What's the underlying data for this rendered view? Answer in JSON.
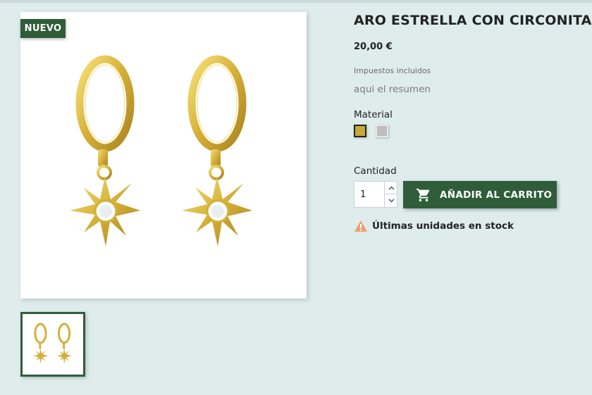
{
  "product": {
    "badge": "NUEVO",
    "title": "ARO ESTRELLA CON CIRCONITA",
    "price": "20,00 €",
    "tax_note": "Impuestos incluidos",
    "summary": "aqui el resumen",
    "material_label": "Material",
    "materials": [
      {
        "name": "gold",
        "color": "#c9a93a",
        "selected": true
      },
      {
        "name": "silver",
        "color": "#bdbdbd",
        "selected": false
      }
    ]
  },
  "purchase": {
    "quantity_label": "Cantidad",
    "quantity_value": "1",
    "add_to_cart_label": "AÑADIR AL CARRITO",
    "stock_message": "Últimas unidades en stock"
  },
  "theme": {
    "accent": "#2f5d3a",
    "background": "#deecec",
    "warning": "#f39d72",
    "gold": "#d4af37"
  },
  "icons": {
    "cart": "shopping-cart-icon",
    "warning": "warning-icon",
    "up": "chevron-up-icon",
    "down": "chevron-down-icon"
  }
}
